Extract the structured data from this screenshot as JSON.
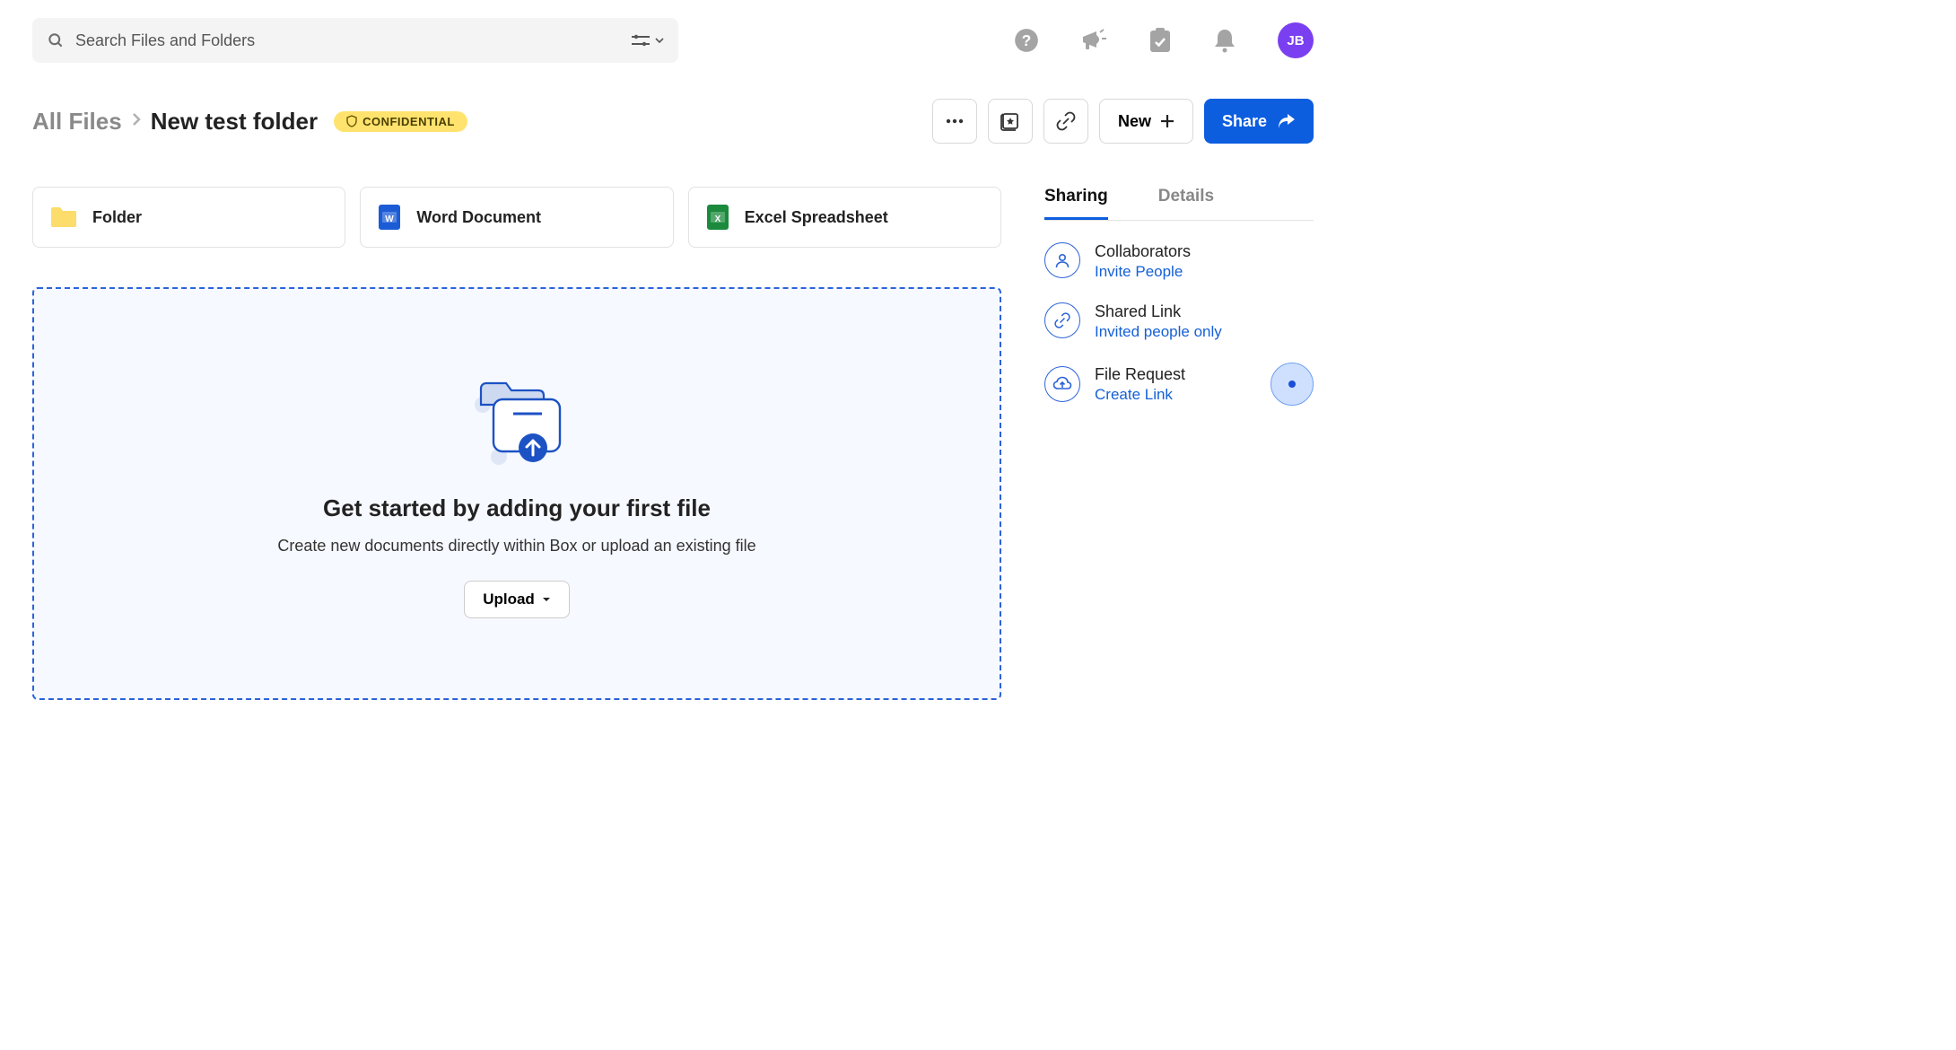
{
  "search": {
    "placeholder": "Search Files and Folders"
  },
  "avatar": {
    "initials": "JB"
  },
  "breadcrumb": {
    "root": "All Files",
    "current": "New test folder",
    "badge": "CONFIDENTIAL"
  },
  "actions": {
    "new_label": "New",
    "share_label": "Share"
  },
  "templates": [
    {
      "label": "Folder"
    },
    {
      "label": "Word Document"
    },
    {
      "label": "Excel Spreadsheet"
    }
  ],
  "dropzone": {
    "title": "Get started by adding your first file",
    "subtitle": "Create new documents directly within Box or upload an existing file",
    "upload_label": "Upload"
  },
  "sidebar": {
    "tabs": {
      "sharing": "Sharing",
      "details": "Details"
    },
    "collaborators": {
      "title": "Collaborators",
      "action": "Invite People"
    },
    "shared_link": {
      "title": "Shared Link",
      "action": "Invited people only"
    },
    "file_request": {
      "title": "File Request",
      "action": "Create Link"
    }
  }
}
